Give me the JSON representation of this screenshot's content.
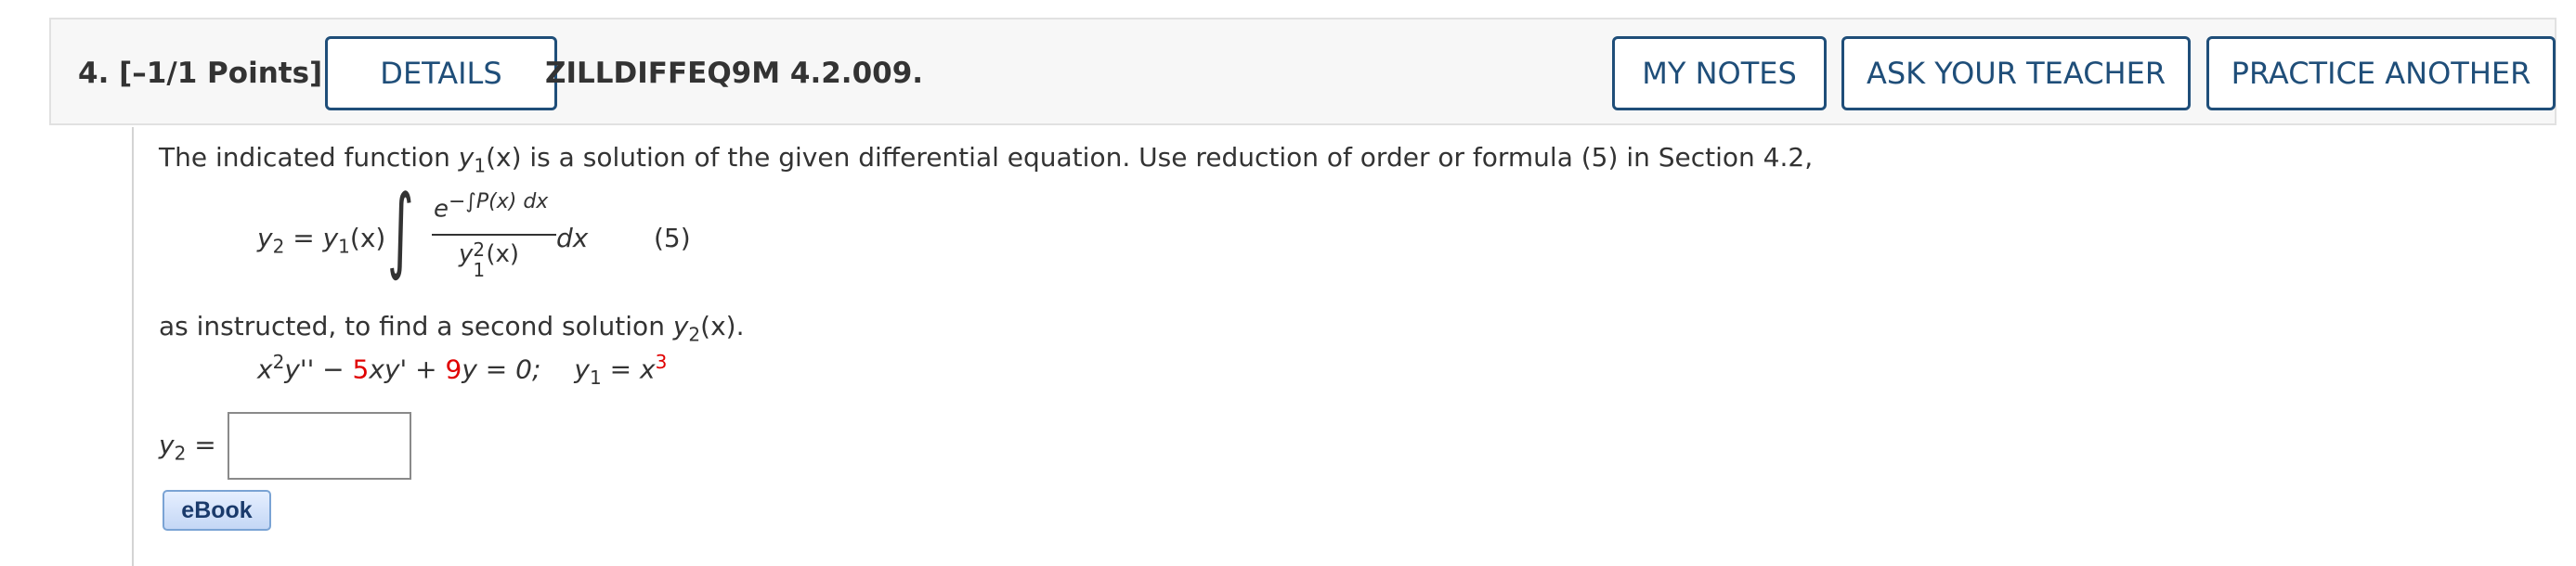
{
  "header": {
    "question_label": "4. [–1/1 Points]",
    "details_label": "DETAILS",
    "code": "ZILLDIFFEQ9M 4.2.009.",
    "my_notes_label": "MY NOTES",
    "ask_teacher_label": "ASK YOUR TEACHER",
    "practice_label": "PRACTICE ANOTHER"
  },
  "question": {
    "intro_pre": "The indicated function ",
    "intro_func_y": "y",
    "intro_func_sub": "1",
    "intro_func_arg": "(x)",
    "intro_post": " is a solution of the given differential equation. Use reduction of order or formula (5) in Section 4.2,",
    "formula": {
      "lhs_y": "y",
      "lhs_sub": "2",
      "eq": " = ",
      "rhs_y": "y",
      "rhs_sub": "1",
      "rhs_arg": "(x)",
      "integral": "∫",
      "num_base": "e",
      "num_exp": "−∫P(x) dx",
      "den_y": "y",
      "den_sup": "2",
      "den_sub": "1",
      "den_arg": "(x)",
      "dx": "dx",
      "eq_number": "(5)"
    },
    "instruction_pre": "as instructed, to find a second solution ",
    "instruction_y": "y",
    "instruction_sub": "2",
    "instruction_post": "(x).",
    "equation": {
      "x": "x",
      "x_sup": "2",
      "ypp": "y'' − ",
      "coef1": "5",
      "term1": "xy' + ",
      "coef2": "9",
      "term2": "y = 0;",
      "y1": "y",
      "y1_sub": "1",
      "eq": " = x",
      "exp": "3"
    },
    "answer_label_y": "y",
    "answer_label_sub": "2",
    "answer_label_eq": " =",
    "answer_value": "",
    "ebook_label": "eBook"
  },
  "colors": {
    "button_border": "#1f4e79",
    "header_bg": "#f7f7f7",
    "highlight_red": "#e00000"
  }
}
